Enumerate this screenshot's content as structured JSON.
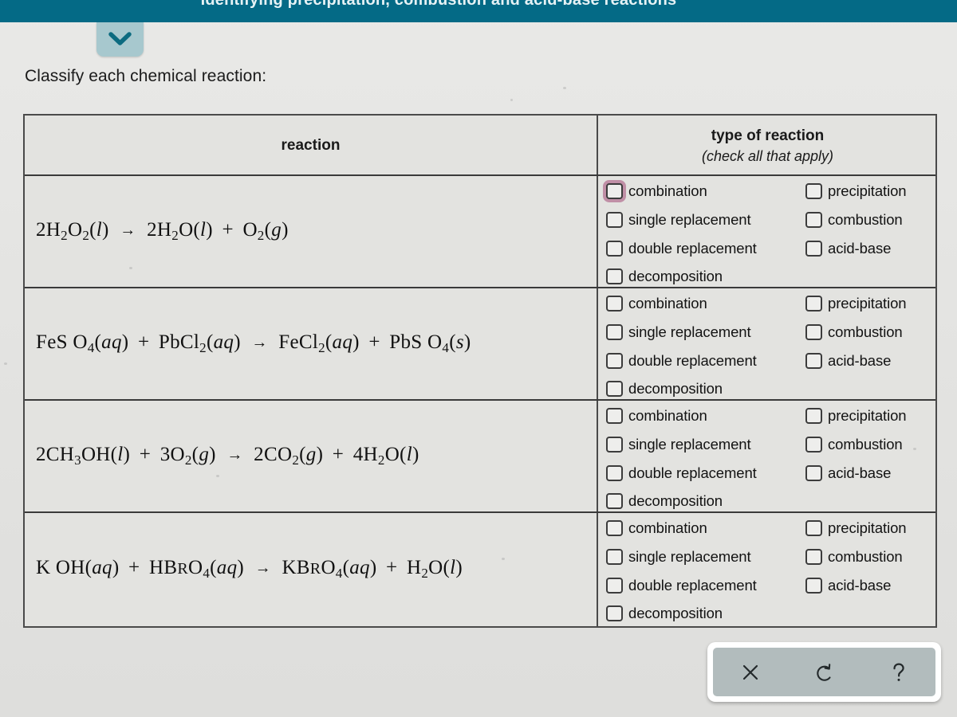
{
  "header": {
    "title": "Identifying precipitation, combustion and acid-base reactions",
    "accent_color": "#046a86"
  },
  "collapse_tab": {
    "icon": "chevron-down-icon",
    "background_color": "#a7c8ce",
    "icon_color": "#0c6b80"
  },
  "prompt": "Classify each chemical reaction:",
  "table": {
    "headers": {
      "reaction": "reaction",
      "type_main": "type of reaction",
      "type_sub": "(check all that apply)"
    },
    "rows": [
      {
        "equation_html": "2H<sub>2</sub>O<sub>2</sub>(<i>l</i>) <span class=\"arrow\">&#8594;</span> 2H<sub>2</sub>O(<i>l</i>) <span class=\"plus\">+</span> O<sub>2</sub>(<i>g</i>)",
        "equation_text": "2H2O2(l) -> 2H2O(l) + O2(g)",
        "options": [
          {
            "label": "combination",
            "checked": false,
            "focused": true
          },
          {
            "label": "single replacement",
            "checked": false,
            "focused": false
          },
          {
            "label": "double replacement",
            "checked": false,
            "focused": false
          },
          {
            "label": "decomposition",
            "checked": false,
            "focused": false
          },
          {
            "label": "precipitation",
            "checked": false,
            "focused": false
          },
          {
            "label": "combustion",
            "checked": false,
            "focused": false
          },
          {
            "label": "acid-base",
            "checked": false,
            "focused": false
          }
        ]
      },
      {
        "equation_html": "FeS O<sub>4</sub>(<i>aq</i>) <span class=\"plus\">+</span> PbCl<sub>2</sub>(<i>aq</i>) <span class=\"arrow\">&#8594;</span> FeCl<sub>2</sub>(<i>aq</i>) <span class=\"plus\">+</span> PbS O<sub>4</sub>(<i>s</i>)",
        "equation_text": "FeSO4(aq) + PbCl2(aq) -> FeCl2(aq) + PbSO4(s)",
        "options": [
          {
            "label": "combination",
            "checked": false,
            "focused": false
          },
          {
            "label": "single replacement",
            "checked": false,
            "focused": false
          },
          {
            "label": "double replacement",
            "checked": false,
            "focused": false
          },
          {
            "label": "decomposition",
            "checked": false,
            "focused": false
          },
          {
            "label": "precipitation",
            "checked": false,
            "focused": false
          },
          {
            "label": "combustion",
            "checked": false,
            "focused": false
          },
          {
            "label": "acid-base",
            "checked": false,
            "focused": false
          }
        ]
      },
      {
        "equation_html": "2CH<sub>3</sub>OH(<i>l</i>) <span class=\"plus\">+</span> 3O<sub>2</sub>(<i>g</i>) <span class=\"arrow\">&#8594;</span> 2CO<sub>2</sub>(<i>g</i>) <span class=\"plus\">+</span> 4H<sub>2</sub>O(<i>l</i>)",
        "equation_text": "2CH3OH(l) + 3O2(g) -> 2CO2(g) + 4H2O(l)",
        "options": [
          {
            "label": "combination",
            "checked": false,
            "focused": false
          },
          {
            "label": "single replacement",
            "checked": false,
            "focused": false
          },
          {
            "label": "double replacement",
            "checked": false,
            "focused": false
          },
          {
            "label": "decomposition",
            "checked": false,
            "focused": false
          },
          {
            "label": "precipitation",
            "checked": false,
            "focused": false
          },
          {
            "label": "combustion",
            "checked": false,
            "focused": false
          },
          {
            "label": "acid-base",
            "checked": false,
            "focused": false
          }
        ]
      },
      {
        "equation_html": "K OH(<i>aq</i>) <span class=\"plus\">+</span> HB<span style=\"font-size:.8em\">R</span>O<sub>4</sub>(<i>aq</i>) <span class=\"arrow\">&#8594;</span> KB<span style=\"font-size:.8em\">R</span>O<sub>4</sub>(<i>aq</i>) <span class=\"plus\">+</span> H<sub>2</sub>O(<i>l</i>)",
        "equation_text": "KOH(aq) + HBrO4(aq) -> KBrO4(aq) + H2O(l)",
        "options": [
          {
            "label": "combination",
            "checked": false,
            "focused": false
          },
          {
            "label": "single replacement",
            "checked": false,
            "focused": false
          },
          {
            "label": "double replacement",
            "checked": false,
            "focused": false
          },
          {
            "label": "decomposition",
            "checked": false,
            "focused": false
          },
          {
            "label": "precipitation",
            "checked": false,
            "focused": false
          },
          {
            "label": "combustion",
            "checked": false,
            "focused": false
          },
          {
            "label": "acid-base",
            "checked": false,
            "focused": false
          }
        ]
      }
    ]
  },
  "toolbar": {
    "buttons": [
      {
        "name": "close-button",
        "icon": "close-x-icon",
        "label": "×"
      },
      {
        "name": "reset-button",
        "icon": "undo-arrow-icon",
        "label": "↺"
      },
      {
        "name": "help-button",
        "icon": "question-mark-icon",
        "label": "?"
      }
    ],
    "background_color": "#b2bcbd"
  },
  "focus_ring_color": "#c08fa6"
}
